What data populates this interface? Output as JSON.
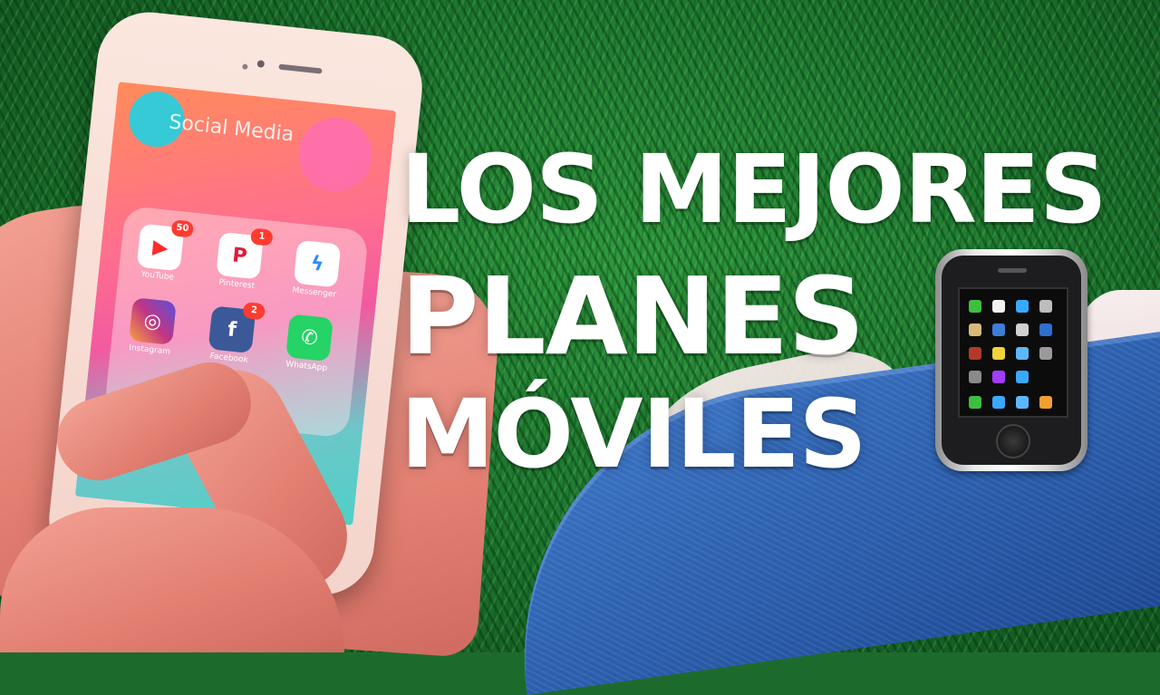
{
  "headline": {
    "line1": "LOS MEJORES",
    "line2": "PLANES",
    "line3": "MÓVILES"
  },
  "phone": {
    "folder_title": "Social Media",
    "apps": [
      {
        "name": "YouTube",
        "badge": "50",
        "color": "#ff2b2b",
        "glyph": "▶"
      },
      {
        "name": "Pinterest",
        "badge": "1",
        "color": "#e3193a",
        "glyph": "P"
      },
      {
        "name": "Messenger",
        "badge": "",
        "color": "#2d8cff",
        "glyph": "ϟ"
      },
      {
        "name": "Instagram",
        "badge": "",
        "color": "#c13584",
        "glyph": "◎"
      },
      {
        "name": "Facebook",
        "badge": "2",
        "color": "#3b5998",
        "glyph": "f"
      },
      {
        "name": "WhatsApp",
        "badge": "",
        "color": "#25d366",
        "glyph": "✆"
      }
    ]
  },
  "emoji": "mobile-phone-icon",
  "colors": {
    "grass": "#1f7a30",
    "jeans": "#2b5fae",
    "headline_text": "#ffffff"
  }
}
